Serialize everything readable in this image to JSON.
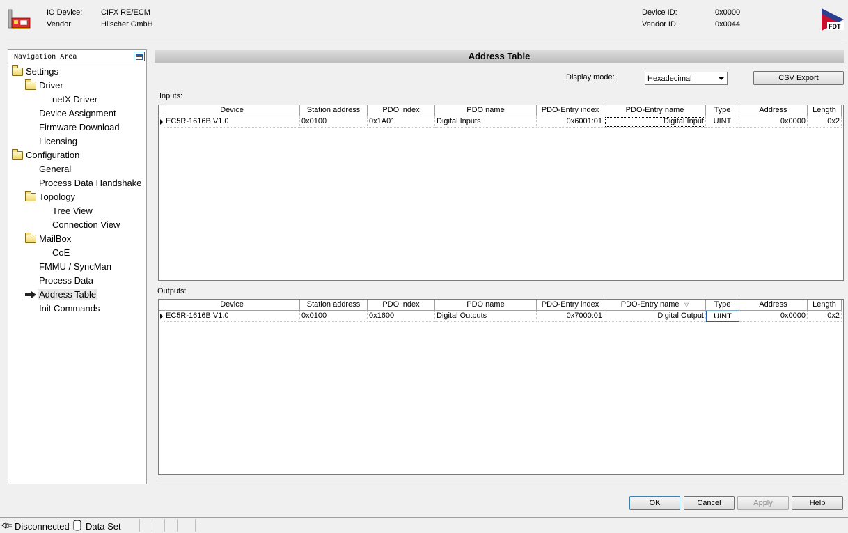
{
  "header": {
    "io_device_label": "IO Device:",
    "io_device_value": "CIFX RE/ECM",
    "vendor_label": "Vendor:",
    "vendor_value": "Hilscher GmbH",
    "device_id_label": "Device ID:",
    "device_id_value": "0x0000",
    "vendor_id_label": "Vendor ID:",
    "vendor_id_value": "0x0044",
    "logo_text": "FDT"
  },
  "nav": {
    "title": "Navigation Area",
    "items": [
      {
        "label": "Settings",
        "icon": "folder-icon",
        "level": 0
      },
      {
        "label": "Driver",
        "icon": "folder-icon",
        "level": 1
      },
      {
        "label": "netX Driver",
        "icon": "",
        "level": 2
      },
      {
        "label": "Device Assignment",
        "icon": "",
        "level": 1
      },
      {
        "label": "Firmware Download",
        "icon": "",
        "level": 1
      },
      {
        "label": "Licensing",
        "icon": "",
        "level": 1
      },
      {
        "label": "Configuration",
        "icon": "folder-icon",
        "level": 0
      },
      {
        "label": "General",
        "icon": "",
        "level": 1
      },
      {
        "label": "Process Data Handshake",
        "icon": "",
        "level": 1
      },
      {
        "label": "Topology",
        "icon": "folder-icon",
        "level": 1
      },
      {
        "label": "Tree View",
        "icon": "",
        "level": 2
      },
      {
        "label": "Connection View",
        "icon": "",
        "level": 2
      },
      {
        "label": "MailBox",
        "icon": "folder-icon",
        "level": 1
      },
      {
        "label": "CoE",
        "icon": "",
        "level": 2
      },
      {
        "label": "FMMU / SyncMan",
        "icon": "",
        "level": 1
      },
      {
        "label": "Process Data",
        "icon": "",
        "level": 1
      },
      {
        "label": "Address Table",
        "icon": "arrow-icon",
        "level": 1,
        "selected": true
      },
      {
        "label": "Init Commands",
        "icon": "",
        "level": 1
      }
    ]
  },
  "content": {
    "title": "Address Table",
    "display_mode_label": "Display mode:",
    "display_mode_value": "Hexadecimal",
    "csv_export_label": "CSV Export",
    "inputs_label": "Inputs:",
    "outputs_label": "Outputs:",
    "columns": [
      "Device",
      "Station address",
      "PDO index",
      "PDO name",
      "PDO-Entry index",
      "PDO-Entry name",
      "Type",
      "Address",
      "Length"
    ],
    "inputs_rows": [
      [
        "EC5R-1616B V1.0",
        "0x0100",
        "0x1A01",
        "Digital Inputs",
        "0x6001:01",
        "Digital Input",
        "UINT",
        "0x0000",
        "0x2"
      ]
    ],
    "outputs_rows": [
      [
        "EC5R-1616B V1.0",
        "0x0100",
        "0x1600",
        "Digital Outputs",
        "0x7000:01",
        "Digital Output",
        "UINT",
        "0x0000",
        "0x2"
      ]
    ]
  },
  "buttons": {
    "ok": "OK",
    "cancel": "Cancel",
    "apply": "Apply",
    "help": "Help"
  },
  "status": {
    "connection": "Disconnected",
    "data_set": "Data Set"
  }
}
